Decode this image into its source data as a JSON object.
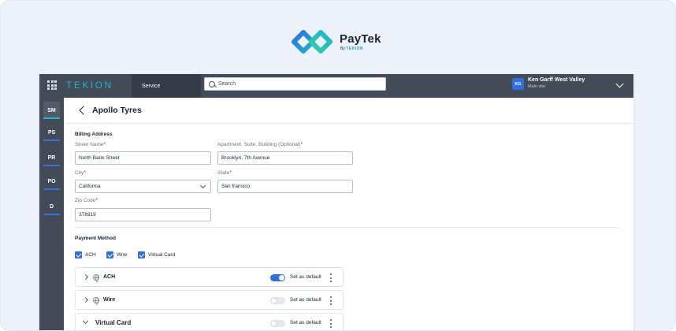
{
  "brand": {
    "name": "PayTek",
    "by": "By",
    "by_company": "TEKION",
    "colors": {
      "primary": "#2f6fe0",
      "accent": "#1fb3cc"
    }
  },
  "topbar": {
    "apps_icon": "grid-icon",
    "logo": "TEKION",
    "service_tab": "Service",
    "search_placeholder": "Search",
    "user": {
      "initials": "KG",
      "name": "Ken Garff West Valley",
      "site": "Main site"
    }
  },
  "leftnav": {
    "items": [
      {
        "label": "SM",
        "active": true
      },
      {
        "label": "PS"
      },
      {
        "label": "PR"
      },
      {
        "label": "PO"
      },
      {
        "label": "D"
      }
    ]
  },
  "page": {
    "title": "Apollo Tyres"
  },
  "billing": {
    "section_title": "Billing Address",
    "street": {
      "label": "Street Name",
      "required": "*",
      "value": "North Bank Street"
    },
    "apartment": {
      "label": "Apartment, Suite, Building (Optional)",
      "required": "*",
      "value": "Brooklyn, 7th Avenue"
    },
    "city": {
      "label": "City",
      "required": "*",
      "value": "California"
    },
    "state": {
      "label": "State",
      "required": "*",
      "value": "San fransico"
    },
    "zip": {
      "label": "Zip Code",
      "required": "*",
      "value": "378919"
    }
  },
  "payment": {
    "section_title": "Payment Method",
    "checkboxes": [
      {
        "label": "ACH",
        "checked": true
      },
      {
        "label": "Wire",
        "checked": true
      },
      {
        "label": "Virtual Card",
        "checked": true
      }
    ],
    "methods": [
      {
        "label": "ACH",
        "default_label": "Set as default",
        "default_on": true
      },
      {
        "label": "Wire",
        "default_label": "Set as default",
        "default_on": false
      },
      {
        "label": "Virtual Card",
        "default_label": "Set as default",
        "default_on": false
      }
    ]
  }
}
